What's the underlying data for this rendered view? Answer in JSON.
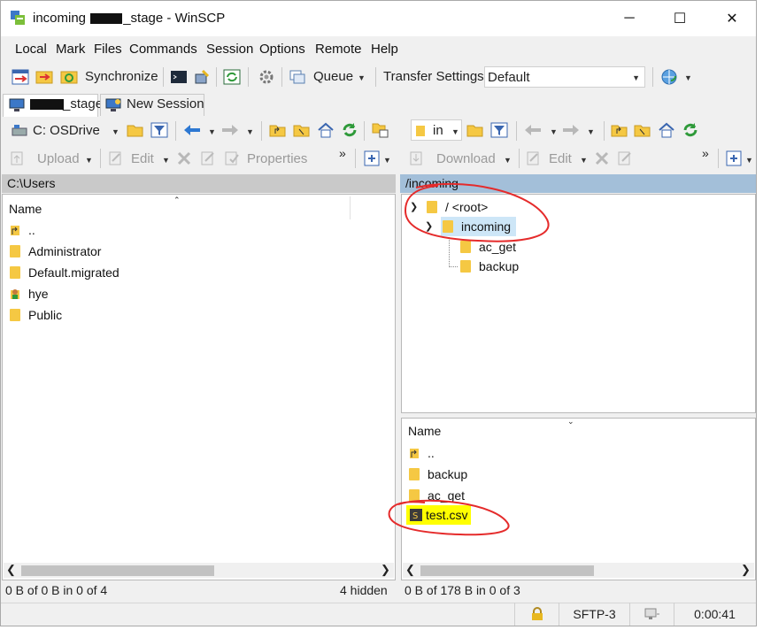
{
  "window": {
    "title_prefix": "incoming",
    "title_suffix": "_stage - WinSCP",
    "min_glyph": "─",
    "max_glyph": "☐",
    "close_glyph": "✕"
  },
  "menu": [
    "Local",
    "Mark",
    "Files",
    "Commands",
    "Session",
    "Options",
    "Remote",
    "Help"
  ],
  "toolbar": {
    "synchronize": "Synchronize",
    "queue": "Queue",
    "transfer_settings_label": "Transfer Settings",
    "transfer_settings_value": "Default"
  },
  "tabs": {
    "session": "_stage",
    "new_session": "New Session"
  },
  "local": {
    "drive": "C: OSDrive",
    "upload": "Upload",
    "edit": "Edit",
    "properties": "Properties",
    "path": "C:\\Users",
    "col_name": "Name",
    "files": [
      {
        "name": "..",
        "icon": "parent-dir-icon"
      },
      {
        "name": "Administrator",
        "icon": "folder-icon"
      },
      {
        "name": "Default.migrated",
        "icon": "folder-icon"
      },
      {
        "name": "hye",
        "icon": "user-folder-icon"
      },
      {
        "name": "Public",
        "icon": "folder-icon"
      }
    ],
    "status_left": "0 B of 0 B in 0 of 4",
    "status_hidden": "4 hidden"
  },
  "remote": {
    "dir_combo": "in",
    "download": "Download",
    "edit": "Edit",
    "path": "/incoming",
    "tree": {
      "root": "/ <root>",
      "incoming": "incoming",
      "ac_get": "ac_get",
      "backup": "backup"
    },
    "col_name": "Name",
    "files": [
      {
        "name": "..",
        "icon": "parent-dir-icon"
      },
      {
        "name": "backup",
        "icon": "folder-icon"
      },
      {
        "name": "ac_get",
        "icon": "folder-icon"
      },
      {
        "name": "test.csv",
        "icon": "csv-file-icon"
      }
    ],
    "status_left": "0 B of 178 B in 0 of 3"
  },
  "statusbar": {
    "protocol": "SFTP-3",
    "time": "0:00:41"
  },
  "colors": {
    "annotation": "#e52b2b",
    "highlight": "#ffff00",
    "path_bar_active": "#a3bfd9",
    "path_bar_inactive": "#c9c9c9",
    "tree_selected": "#cde6f7"
  }
}
